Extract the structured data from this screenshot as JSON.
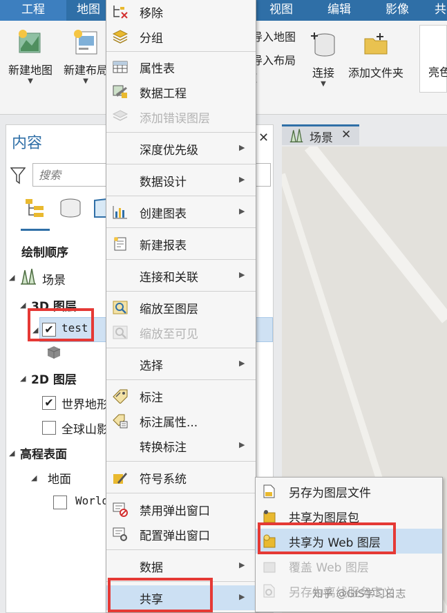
{
  "ribbon": {
    "tabs": [
      "工程",
      "地图",
      "视图",
      "编辑",
      "影像"
    ],
    "tab_overflow": "共",
    "new_map": "新建地图",
    "new_layout": "新建布局",
    "import_map": "导入地图",
    "import_layout": "导入布局",
    "connect": "连接",
    "add_folder": "添加文件夹",
    "brightness": "亮色"
  },
  "contents": {
    "title": "内容",
    "search_placeholder": "搜索",
    "section_draw_order": "绘制顺序",
    "scene": "场景",
    "layers_3d": "3D 图层",
    "layer_test": "test",
    "layers_2d": "2D 图层",
    "world_map": "世界地形",
    "global_shade": "全球山影",
    "elevation": "高程表面",
    "ground": "地面",
    "world_elev": "World"
  },
  "view": {
    "tab_label": "场景"
  },
  "context_menu": {
    "remove": "移除",
    "group": "分组",
    "attribute_table": "属性表",
    "data_engineering": "数据工程",
    "add_error_layer": "添加错误图层",
    "depth_priority": "深度优先级",
    "data_design": "数据设计",
    "create_chart": "创建图表",
    "new_report": "新建报表",
    "joins_relates": "连接和关联",
    "zoom_to_layer": "缩放至图层",
    "zoom_to_visible": "缩放至可见",
    "selection": "选择",
    "label": "标注",
    "label_properties": "标注属性...",
    "convert_labels": "转换标注",
    "symbology": "符号系统",
    "disable_popups": "禁用弹出窗口",
    "configure_popups": "配置弹出窗口",
    "data": "数据",
    "share": "共享"
  },
  "share_menu": {
    "save_layer_file": "另存为图层文件",
    "share_layer_package": "共享为图层包",
    "share_web_layer": "共享为 Web 图层",
    "overwrite_web_layer": "覆盖 Web 图层",
    "save_offline_service": "另存为离线服务定义"
  },
  "watermark": "知乎 @GIS学习日志",
  "colors": {
    "accent": "#2f6fa7",
    "highlight": "#cce0f3",
    "red_box": "#e53935"
  }
}
